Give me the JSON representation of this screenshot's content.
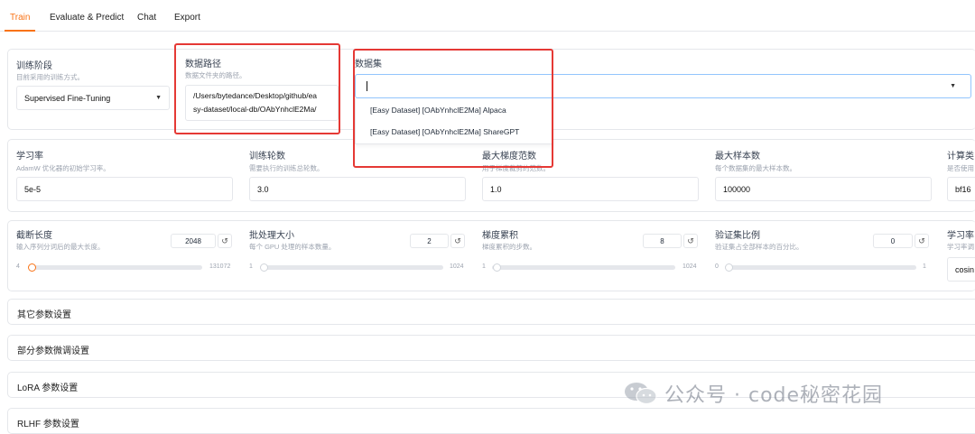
{
  "tabs": [
    {
      "label": "Train"
    },
    {
      "label": "Evaluate & Predict"
    },
    {
      "label": "Chat"
    },
    {
      "label": "Export"
    }
  ],
  "stage": {
    "label": "训练阶段",
    "info": "目前采用的训练方式。",
    "value": "Supervised Fine-Tuning"
  },
  "dataset_dir": {
    "label": "数据路径",
    "info": "数据文件夹的路径。",
    "value_line1": "/Users/bytedance/Desktop/github/ea",
    "value_line2": "sy-dataset/local-db/OAbYnhclE2Ma/"
  },
  "dataset": {
    "label": "数据集",
    "value": "",
    "options": [
      "[Easy Dataset] [OAbYnhclE2Ma] Alpaca",
      "[Easy Dataset] [OAbYnhclE2Ma] ShareGPT"
    ]
  },
  "row2": [
    {
      "label": "学习率",
      "info": "AdamW 优化器的初始学习率。",
      "value": "5e-5"
    },
    {
      "label": "训练轮数",
      "info": "需要执行的训练总轮数。",
      "value": "3.0"
    },
    {
      "label": "最大梯度范数",
      "info": "用于梯度裁剪的范数。",
      "value": "1.0"
    },
    {
      "label": "最大样本数",
      "info": "每个数据集的最大样本数。",
      "value": "100000"
    },
    {
      "label": "计算类",
      "info": "是否使用",
      "value": "bf16"
    }
  ],
  "row3": [
    {
      "label": "截断长度",
      "info": "输入序列分词后的最大长度。",
      "value": "2048",
      "min": "4",
      "max": "131072",
      "fraction": 0.015
    },
    {
      "label": "批处理大小",
      "info": "每个 GPU 处理的样本数量。",
      "value": "2",
      "min": "1",
      "max": "1024",
      "fraction": 0.001
    },
    {
      "label": "梯度累积",
      "info": "梯度累积的步数。",
      "value": "8",
      "min": "1",
      "max": "1024",
      "fraction": 0.007
    },
    {
      "label": "验证集比例",
      "info": "验证集占全部样本的百分比。",
      "value": "0",
      "min": "0",
      "max": "1",
      "fraction": 0.0
    },
    {
      "label": "学习率",
      "info": "学习率调",
      "value": "cosin"
    }
  ],
  "accordions": [
    {
      "label": "其它参数设置"
    },
    {
      "label": "部分参数微调设置"
    },
    {
      "label": "LoRA 参数设置"
    },
    {
      "label": "RLHF 参数设置"
    }
  ],
  "watermark": {
    "text": "公众号 · code秘密花园"
  },
  "colors": {
    "accent": "#f97316",
    "highlight": "#e53935"
  }
}
